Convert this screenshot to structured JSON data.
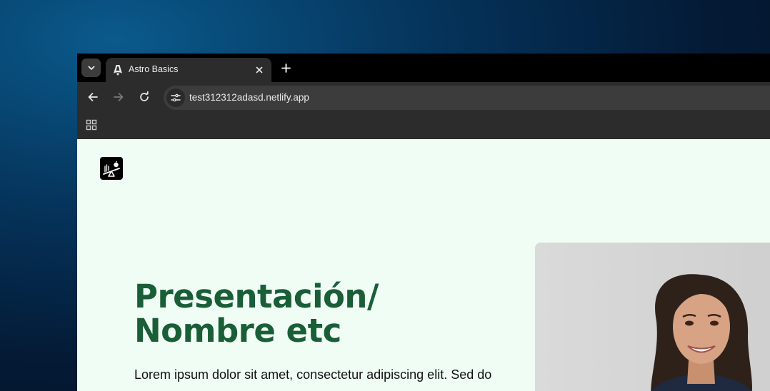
{
  "browser": {
    "tab": {
      "title": "Astro Basics"
    },
    "address_bar": {
      "url": "test312312adasd.netlify.app"
    }
  },
  "page": {
    "hero": {
      "title_line1": "Presentación/",
      "title_line2": "Nombre etc",
      "text": "Lorem ipsum dolor sit amet, consectetur adipiscing elit. Sed do"
    },
    "photo": {
      "alt": "portrait"
    }
  },
  "colors": {
    "page_bg": "#effdf4",
    "title_green": "#1a5e37",
    "chrome_dark": "#2c2c2c"
  }
}
